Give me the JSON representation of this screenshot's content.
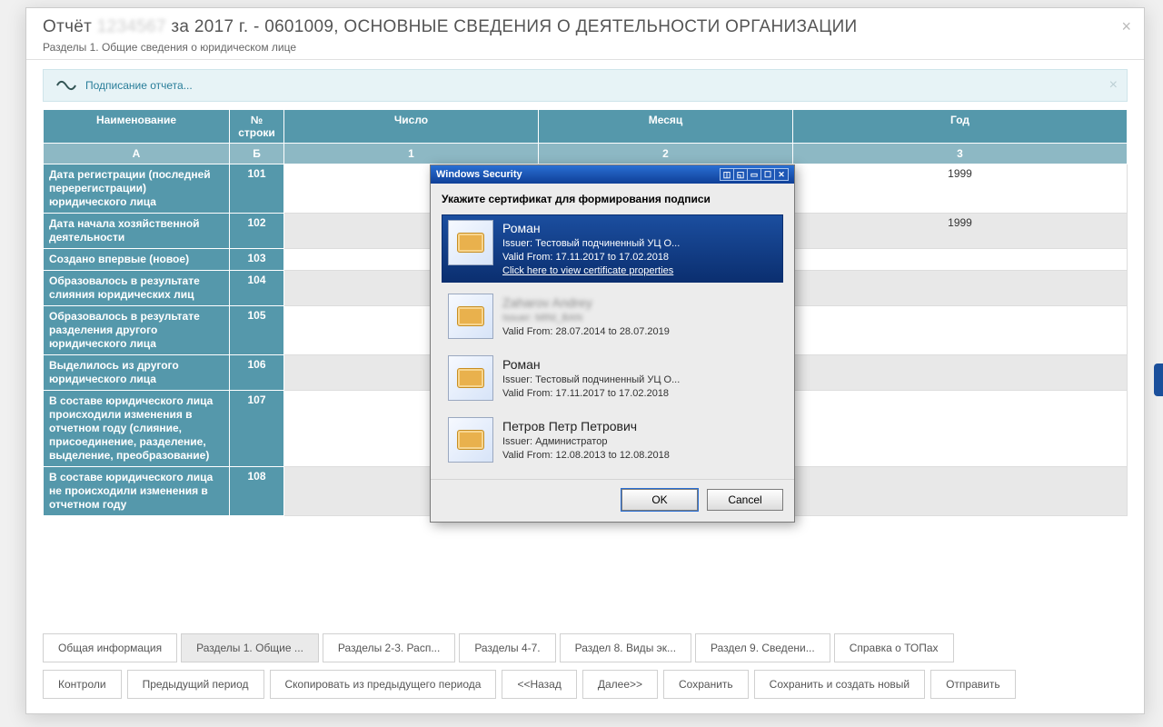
{
  "header": {
    "prefix": "Отчёт",
    "masked_id": "1234567",
    "title_rest": "за 2017 г. - 0601009, ОСНОВНЫЕ СВЕДЕНИЯ О ДЕЯТЕЛЬНОСТИ ОРГАНИЗАЦИИ",
    "subtitle": "Разделы 1. Общие сведения о юридическом лице",
    "close": "×"
  },
  "banner": {
    "text": "Подписание отчета...",
    "close": "×"
  },
  "grid": {
    "headers": {
      "name": "Наименование",
      "row": "№ строки",
      "day": "Число",
      "month": "Месяц",
      "year": "Год"
    },
    "subheaders": {
      "name": "А",
      "row": "Б",
      "day": "1",
      "month": "2",
      "year": "3"
    },
    "rows": [
      {
        "name": "Дата регистрации (последней перерегистрации) юридического лица",
        "num": "101",
        "year": "1999"
      },
      {
        "name": "Дата начала хозяйственной деятельности",
        "num": "102",
        "year": "1999"
      },
      {
        "name": "Создано впервые (новое)",
        "num": "103",
        "year": ""
      },
      {
        "name": "Образовалось в результате слияния юридических лиц",
        "num": "104",
        "year": ""
      },
      {
        "name": "Образовалось в результате разделения другого юридического лица",
        "num": "105",
        "year": ""
      },
      {
        "name": "Выделилось из другого юридического лица",
        "num": "106",
        "year": ""
      },
      {
        "name": "В составе юридического лица происходили изменения в отчетном году (слияние, присоединение, разделение, выделение, преобразование)",
        "num": "107",
        "year": ""
      },
      {
        "name": "В составе юридического лица не происходили изменения в отчетном году",
        "num": "108",
        "year": ""
      }
    ]
  },
  "dialog": {
    "title": "Windows Security",
    "prompt": "Укажите сертификат для формирования подписи",
    "ok": "OK",
    "cancel": "Cancel",
    "view_props": "Click here to view certificate properties",
    "certs": [
      {
        "name": "Роман",
        "issuer": "Issuer: Тестовый подчиненный УЦ О...",
        "valid": "Valid From: 17.11.2017 to 17.02.2018",
        "selected": true
      },
      {
        "name": "Zaharov Andrey",
        "issuer": "Issuer: MINI_BAN",
        "valid": "Valid From: 28.07.2014 to 28.07.2019",
        "blurred": true
      },
      {
        "name": "Роман",
        "issuer": "Issuer: Тестовый подчиненный УЦ О...",
        "valid": "Valid From: 17.11.2017 to 17.02.2018"
      },
      {
        "name": "Петров Петр Петрович",
        "issuer": "Issuer: Администратор",
        "valid": "Valid From: 12.08.2013 to 12.08.2018"
      }
    ]
  },
  "tabs": [
    {
      "label": "Общая информация"
    },
    {
      "label": "Разделы 1. Общие ...",
      "active": true
    },
    {
      "label": "Разделы 2-3. Расп..."
    },
    {
      "label": "Разделы 4-7."
    },
    {
      "label": "Раздел 8. Виды эк..."
    },
    {
      "label": "Раздел 9. Сведени..."
    },
    {
      "label": "Справка о ТОПах"
    }
  ],
  "actions": [
    "Контроли",
    "Предыдущий период",
    "Скопировать из предыдущего периода",
    "<<Назад",
    "Далее>>",
    "Сохранить",
    "Сохранить и создать новый",
    "Отправить"
  ]
}
